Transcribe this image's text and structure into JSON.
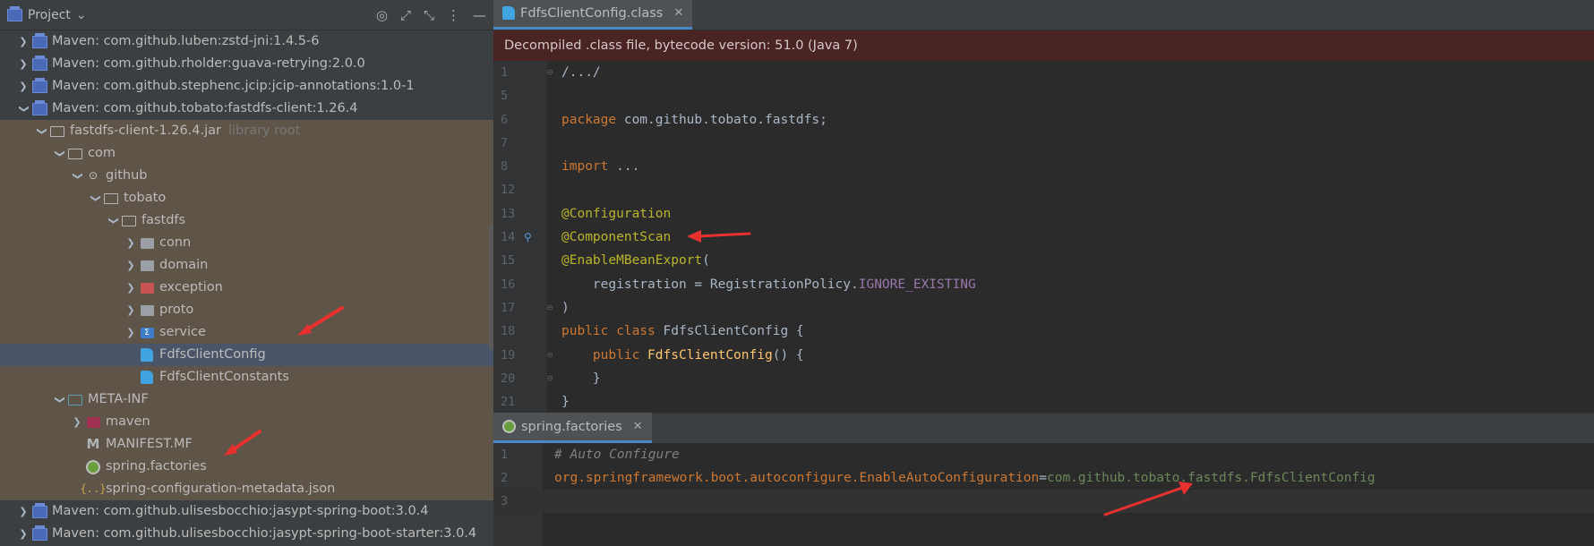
{
  "project_panel": {
    "title": "Project",
    "tree": [
      {
        "label": "Maven: com.github.luben:zstd-jni:1.4.5-6",
        "arrow": "›",
        "level": 1,
        "icon": "library-icon"
      },
      {
        "label": "Maven: com.github.rholder:guava-retrying:2.0.0",
        "arrow": "›",
        "level": 1,
        "icon": "library-icon"
      },
      {
        "label": "Maven: com.github.stephenc.jcip:jcip-annotations:1.0-1",
        "arrow": "›",
        "level": 1,
        "icon": "library-icon"
      },
      {
        "label": "Maven: com.github.tobato:fastdfs-client:1.26.4",
        "arrow": "⌄",
        "level": 1,
        "icon": "library-icon"
      },
      {
        "label": "fastdfs-client-1.26.4.jar",
        "suffix": "library root",
        "arrow": "⌄",
        "level": 2,
        "icon": "jar-folder-icon"
      },
      {
        "label": "com",
        "arrow": "⌄",
        "level": 3,
        "icon": "folder-icon"
      },
      {
        "label": "github",
        "arrow": "⌄",
        "level": 4,
        "icon": "github-folder-icon"
      },
      {
        "label": "tobato",
        "arrow": "⌄",
        "level": 5,
        "icon": "folder-icon"
      },
      {
        "label": "fastdfs",
        "arrow": "⌄",
        "level": 6,
        "icon": "folder-icon"
      },
      {
        "label": "conn",
        "arrow": "›",
        "level": 7,
        "icon": "package-icon"
      },
      {
        "label": "domain",
        "arrow": "›",
        "level": 7,
        "icon": "package-icon"
      },
      {
        "label": "exception",
        "arrow": "›",
        "level": 7,
        "icon": "exception-package-icon"
      },
      {
        "label": "proto",
        "arrow": "›",
        "level": 7,
        "icon": "package-icon"
      },
      {
        "label": "service",
        "arrow": "›",
        "level": 7,
        "icon": "service-package-icon"
      },
      {
        "label": "FdfsClientConfig",
        "arrow": "",
        "level": 7,
        "icon": "class-icon",
        "selected": true
      },
      {
        "label": "FdfsClientConstants",
        "arrow": "",
        "level": 7,
        "icon": "class-icon"
      },
      {
        "label": "META-INF",
        "arrow": "⌄",
        "level": 3,
        "icon": "meta-folder-icon"
      },
      {
        "label": "maven",
        "arrow": "›",
        "level": 4,
        "icon": "maven-folder-icon"
      },
      {
        "label": "MANIFEST.MF",
        "arrow": "",
        "level": 4,
        "icon": "manifest-icon"
      },
      {
        "label": "spring.factories",
        "arrow": "",
        "level": 4,
        "icon": "spring-icon"
      },
      {
        "label": "spring-configuration-metadata.json",
        "arrow": "",
        "level": 4,
        "icon": "json-icon"
      },
      {
        "label": "Maven: com.github.ulisesbocchio:jasypt-spring-boot:3.0.4",
        "arrow": "›",
        "level": 1,
        "icon": "library-icon"
      },
      {
        "label": "Maven: com.github.ulisesbocchio:jasypt-spring-boot-starter:3.0.4",
        "arrow": "›",
        "level": 1,
        "icon": "library-icon"
      }
    ]
  },
  "editor": {
    "tab_label": "FdfsClientConfig.class",
    "banner": "Decompiled .class file, bytecode version: 51.0 (Java 7)",
    "lines": [
      {
        "n": "1",
        "parts": [
          [
            "plain",
            "/.../"
          ]
        ]
      },
      {
        "n": "5",
        "parts": []
      },
      {
        "n": "6",
        "parts": [
          [
            "kw",
            "package "
          ],
          [
            "plain",
            "com.github.tobato.fastdfs;"
          ]
        ]
      },
      {
        "n": "7",
        "parts": []
      },
      {
        "n": "8",
        "parts": [
          [
            "kw",
            "import "
          ],
          [
            "plain",
            "..."
          ]
        ]
      },
      {
        "n": "12",
        "parts": []
      },
      {
        "n": "13",
        "parts": [
          [
            "ann",
            "@Configuration"
          ]
        ]
      },
      {
        "n": "14",
        "parts": [
          [
            "ann",
            "@ComponentScan"
          ]
        ]
      },
      {
        "n": "15",
        "parts": [
          [
            "ann",
            "@EnableMBeanExport"
          ],
          [
            "plain",
            "("
          ]
        ]
      },
      {
        "n": "16",
        "parts": [
          [
            "plain",
            "    registration = RegistrationPolicy."
          ],
          [
            "const",
            "IGNORE_EXISTING"
          ]
        ]
      },
      {
        "n": "17",
        "parts": [
          [
            "plain",
            ")"
          ]
        ]
      },
      {
        "n": "18",
        "parts": [
          [
            "kw",
            "public class "
          ],
          [
            "plain",
            "FdfsClientConfig {"
          ]
        ]
      },
      {
        "n": "19",
        "parts": [
          [
            "kw",
            "    public "
          ],
          [
            "fn",
            "FdfsClientConfig"
          ],
          [
            "plain",
            "() {"
          ]
        ]
      },
      {
        "n": "20",
        "parts": [
          [
            "plain",
            "    }"
          ]
        ]
      },
      {
        "n": "21",
        "parts": [
          [
            "plain",
            "}"
          ]
        ]
      }
    ]
  },
  "lower_editor": {
    "tab_label": "spring.factories",
    "lines": [
      {
        "n": "1",
        "parts": [
          [
            "cmt",
            "# Auto Configure"
          ]
        ]
      },
      {
        "n": "2",
        "parts": [
          [
            "prop",
            "org.springframework.boot.autoconfigure.EnableAutoConfiguration"
          ],
          [
            "plain",
            "="
          ],
          [
            "pval",
            "com.github.tobato.fastdfs.FdfsClientConfig"
          ]
        ]
      },
      {
        "n": "3",
        "parts": []
      }
    ]
  },
  "colors": {
    "keyword": "#cc7832",
    "annotation": "#bbb529",
    "constant": "#9876aa",
    "banner_bg": "#4a2323",
    "selection": "#4b556a",
    "arrow_red": "#e8312f"
  }
}
